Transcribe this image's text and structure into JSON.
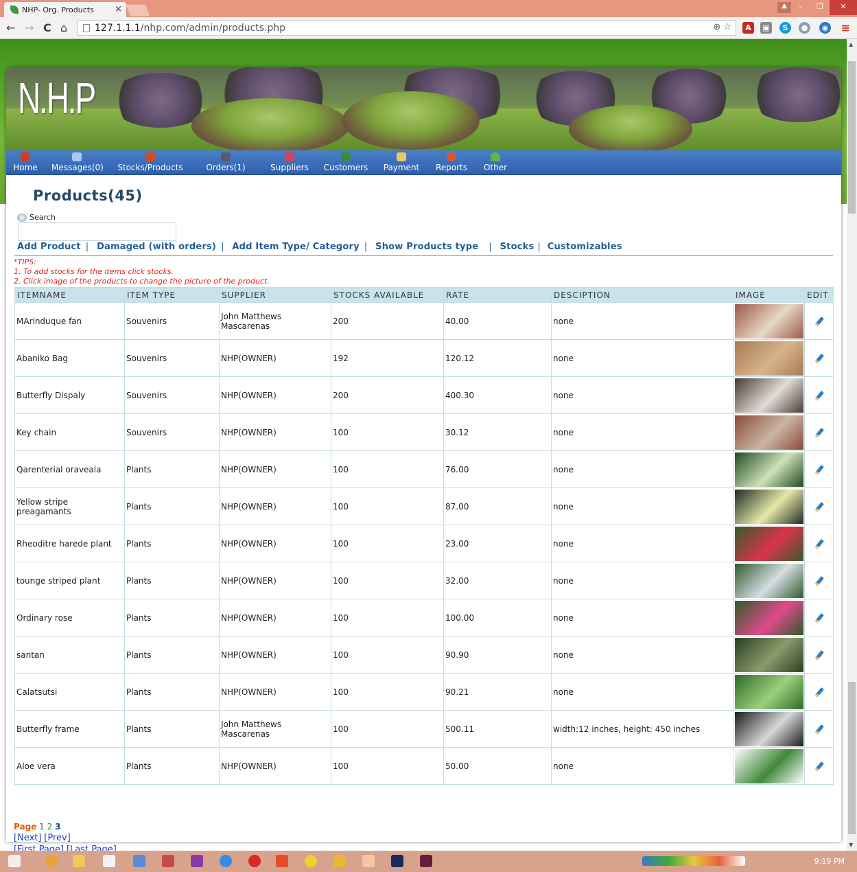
{
  "browser": {
    "tab_title": "NHP- Org. Products",
    "tab_close": "×",
    "url_domain": "127.1.1.1",
    "url_path": "/nhp.com/admin/products.php",
    "back": "←",
    "forward": "→",
    "reload": "C",
    "home": "⌂"
  },
  "site": {
    "logo": "N.H.P",
    "nav": [
      {
        "label": "Home",
        "icon": "house-icon",
        "color": "#d23a2a"
      },
      {
        "label": "Messages(0)",
        "icon": "envelope-icon",
        "color": "#a9c7ee"
      },
      {
        "label": "Stocks/Products",
        "icon": "box-icon",
        "color": "#d24a2e"
      },
      {
        "label": "Orders(1)",
        "icon": "cart-icon",
        "color": "#5a5a6a"
      },
      {
        "label": "Suppliers",
        "icon": "supplier-icon",
        "color": "#d8425a"
      },
      {
        "label": "Customers",
        "icon": "customers-icon",
        "color": "#3a8a3a"
      },
      {
        "label": "Payment",
        "icon": "payment-icon",
        "color": "#f0c860"
      },
      {
        "label": "Reports",
        "icon": "chart-icon",
        "color": "#e8502a"
      },
      {
        "label": "Other",
        "icon": "user-icon",
        "color": "#5fb83a"
      }
    ]
  },
  "page": {
    "title": "Products(45)",
    "search_label": "Search",
    "links": [
      "Add Product",
      "Damaged (with orders)",
      "Add Item Type/ Category",
      "Show Products type",
      "Stocks",
      "Customizables"
    ],
    "tips": [
      "*TIPS:",
      "1. To add stocks for the items click stocks.",
      "2. Click image of the products to change the picture of the product."
    ]
  },
  "table": {
    "headers": [
      "ITEMNAME",
      "ITEM TYPE",
      "SUPPLIER",
      "STOCKS AVAILABLE",
      "RATE",
      "DESCIPTION",
      "IMAGE",
      "EDIT"
    ],
    "rows": [
      {
        "name": "MArinduque fan",
        "type": "Souvenirs",
        "supplier": "John Matthews Mascarenas",
        "stock": "200",
        "rate": "40.00",
        "desc": "none",
        "img": [
          "#9b5a4a",
          "#e8d6c4"
        ]
      },
      {
        "name": "Abaniko Bag",
        "type": "Souvenirs",
        "supplier": "NHP(OWNER)",
        "stock": "192",
        "rate": "120.12",
        "desc": "none",
        "img": [
          "#a87a52",
          "#d7b48a"
        ]
      },
      {
        "name": "Butterfly Dispaly",
        "type": "Souvenirs",
        "supplier": "NHP(OWNER)",
        "stock": "200",
        "rate": "400.30",
        "desc": "none",
        "img": [
          "#4a3a32",
          "#e0dcd6"
        ]
      },
      {
        "name": "Key chain",
        "type": "Souvenirs",
        "supplier": "NHP(OWNER)",
        "stock": "100",
        "rate": "30.12",
        "desc": "none",
        "img": [
          "#8a4a3a",
          "#c9b6a2"
        ]
      },
      {
        "name": "Qarenterial oraveala",
        "type": "Plants",
        "supplier": "NHP(OWNER)",
        "stock": "100",
        "rate": "76.00",
        "desc": "none",
        "img": [
          "#1f4a22",
          "#cfe0b8"
        ]
      },
      {
        "name": "Yellow stripe preagamants",
        "type": "Plants",
        "supplier": "NHP(OWNER)",
        "stock": "100",
        "rate": "87.00",
        "desc": "none",
        "img": [
          "#1e2a22",
          "#e6e8a8"
        ]
      },
      {
        "name": "Rheoditre harede plant",
        "type": "Plants",
        "supplier": "NHP(OWNER)",
        "stock": "100",
        "rate": "23.00",
        "desc": "none",
        "img": [
          "#3a5a2a",
          "#d8344a"
        ]
      },
      {
        "name": "tounge striped plant",
        "type": "Plants",
        "supplier": "NHP(OWNER)",
        "stock": "100",
        "rate": "32.00",
        "desc": "none",
        "img": [
          "#2f5a2e",
          "#d6dde2"
        ]
      },
      {
        "name": "Ordinary rose",
        "type": "Plants",
        "supplier": "NHP(OWNER)",
        "stock": "100",
        "rate": "100.00",
        "desc": "none",
        "img": [
          "#2e5a2a",
          "#e04a8a"
        ]
      },
      {
        "name": "santan",
        "type": "Plants",
        "supplier": "NHP(OWNER)",
        "stock": "100",
        "rate": "90.90",
        "desc": "none",
        "img": [
          "#2a3f22",
          "#8a9a6a"
        ]
      },
      {
        "name": "Calatsutsi",
        "type": "Plants",
        "supplier": "NHP(OWNER)",
        "stock": "100",
        "rate": "90.21",
        "desc": "none",
        "img": [
          "#2f6a2a",
          "#9ad07a"
        ]
      },
      {
        "name": "Butterfly frame",
        "type": "Plants",
        "supplier": "John Matthews Mascarenas",
        "stock": "100",
        "rate": "500.11",
        "desc": "width:12 inches, height: 450 inches",
        "img": [
          "#1a1a1a",
          "#d8d8d8"
        ]
      },
      {
        "name": "Aloe vera",
        "type": "Plants",
        "supplier": "NHP(OWNER)",
        "stock": "100",
        "rate": "50.00",
        "desc": "none",
        "img": [
          "#ffffff",
          "#3f8a3a"
        ]
      }
    ]
  },
  "pager": {
    "word": "Page",
    "p1": "1",
    "p2": "2",
    "p3": "3",
    "next": "[Next]",
    "prev": "[Prev]",
    "first": "[First Page]",
    "last": "[Last Page]"
  },
  "taskbar": {
    "clock": "9:19 PM"
  }
}
